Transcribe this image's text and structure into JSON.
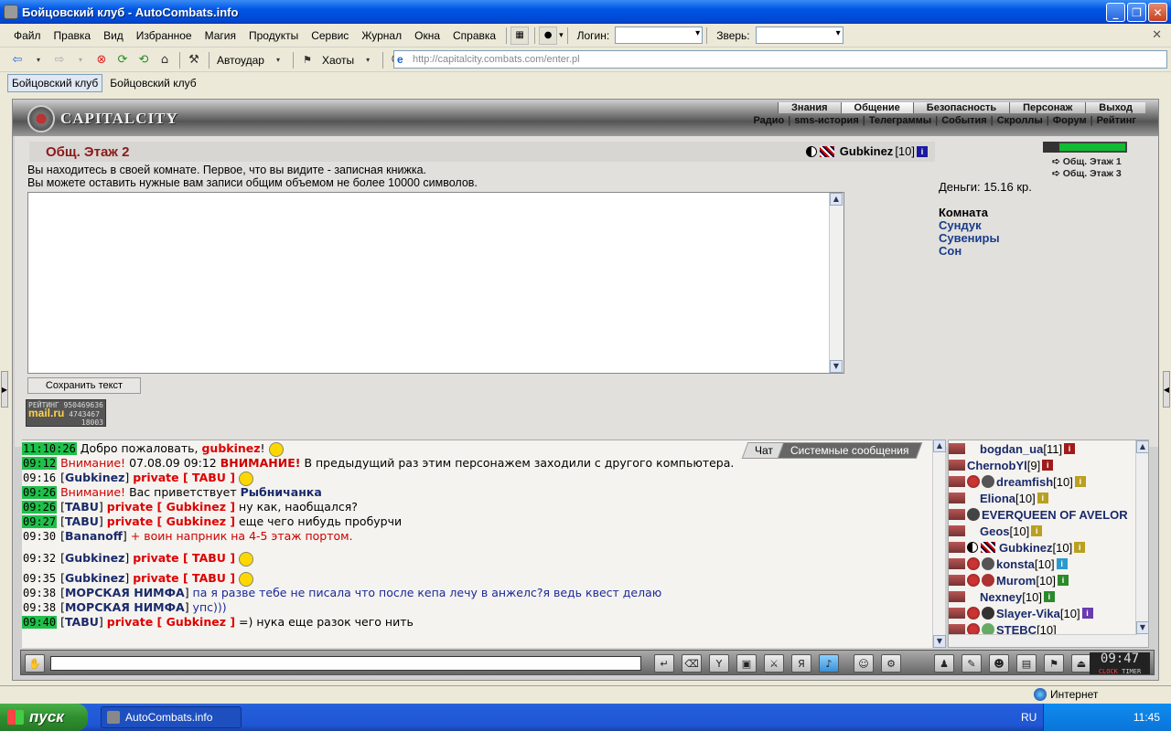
{
  "window": {
    "title": "Бойцовский клуб - AutoCombats.info"
  },
  "menu": {
    "items": [
      "Файл",
      "Правка",
      "Вид",
      "Избранное",
      "Магия",
      "Продукты",
      "Сервис",
      "Журнал",
      "Окна",
      "Справка"
    ],
    "login_label": "Логин:",
    "beast_label": "Зверь:"
  },
  "toolbar": {
    "autoudar": "Автоудар",
    "haoty": "Хаоты",
    "address": "http://capitalcity.combats.com/enter.pl"
  },
  "tabs": [
    "Бойцовский клуб",
    "Бойцовский клуб"
  ],
  "game": {
    "city_name": "CAPITALCITY",
    "nav_top": [
      "Знания",
      "Общение",
      "Безопасность",
      "Персонаж",
      "Выход"
    ],
    "nav_bottom": [
      "Радио",
      "sms-история",
      "Телеграммы",
      "События",
      "Скроллы",
      "Форум",
      "Рейтинг"
    ]
  },
  "room": {
    "title": "Общ. Этаж 2",
    "player_nick": "Gubkinez",
    "player_level": "[10]",
    "desc_line1": "Вы находитесь в своей комнате. Первое, что вы видите - записная книжка.",
    "desc_line2": "Вы можете оставить нужные вам записи общим объемом не более 10000 символов.",
    "save_button": "Сохранить текст",
    "counter_line1": "РЕЙТИНГ 950469636",
    "counter_brand": "mail.ru",
    "counter_line2": "4743467",
    "counter_line3": "18003"
  },
  "right": {
    "floor1": "Общ. Этаж 1",
    "floor3": "Общ. Этаж 3",
    "money": "Деньги: 15.16 кр.",
    "room_label": "Комната",
    "rooms": [
      "Сундук",
      "Сувениры",
      "Сон"
    ]
  },
  "chat": {
    "tab_chat": "Чат",
    "tab_system": "Системные сообщения",
    "lines": [
      {
        "time": "11:10:26",
        "hl": true,
        "pre": "",
        "nick": "",
        "text": "Добро пожаловать, ",
        "tail": "gubkinez",
        "end": "!"
      },
      {
        "time": "09:12",
        "hl": true,
        "warn": "Внимание!",
        "date": "07.08.09 09:12",
        "caps": "ВНИМАНИЕ!",
        "text": "В предыдущий раз этим персонажем заходили с другого компьютера."
      },
      {
        "time": "09:16",
        "hl": false,
        "nick": "Gubkinez",
        "priv": "private [ TABU ]"
      },
      {
        "time": "09:26",
        "hl": true,
        "warn": "Внимание!",
        "text": "Вас приветствует",
        "tail": "Рыбничанка"
      },
      {
        "time": "09:26",
        "hl": true,
        "nick": "TABU",
        "priv": "private [ Gubkinez ]",
        "text": "ну как, наобщался?"
      },
      {
        "time": "09:27",
        "hl": true,
        "nick": "TABU",
        "priv": "private [ Gubkinez ]",
        "text": "еще чего нибудь пробурчи"
      },
      {
        "time": "09:30",
        "hl": false,
        "nick": "Bananoff",
        "text": "+ воин напрник на 4-5 этаж портом."
      },
      {
        "time": "09:32",
        "hl": false,
        "nick": "Gubkinez",
        "priv": "private [ TABU ]"
      },
      {
        "time": "09:35",
        "hl": false,
        "nick": "Gubkinez",
        "priv": "private [ TABU ]"
      },
      {
        "time": "09:38",
        "hl": false,
        "nick": "МОРСКАЯ НИМФА",
        "text": "па я разве тебе не писала что после кепа лечу в анжелс?я ведь квест делаю"
      },
      {
        "time": "09:38",
        "hl": false,
        "nick": "МОРСКАЯ НИМФА",
        "text": "упс)))"
      },
      {
        "time": "09:40",
        "hl": true,
        "nick": "TABU",
        "priv": "private [ Gubkinez ]",
        "text": "=) нука еще разок чего нить"
      }
    ]
  },
  "online": [
    {
      "name": "bogdan_ua",
      "level": "[11]"
    },
    {
      "name": "ChernobYl",
      "level": "[9]"
    },
    {
      "name": "dreamfish",
      "level": "[10]"
    },
    {
      "name": "Eliona",
      "level": "[10]"
    },
    {
      "name": "EVERQUEEN OF AVELOR",
      "level": ""
    },
    {
      "name": "Geos",
      "level": "[10]"
    },
    {
      "name": "Gubkinez",
      "level": "[10]"
    },
    {
      "name": "konsta",
      "level": "[10]"
    },
    {
      "name": "Murom",
      "level": "[10]"
    },
    {
      "name": "Nexney",
      "level": "[10]"
    },
    {
      "name": "Slayer-Vika",
      "level": "[10]"
    },
    {
      "name": "STEBC",
      "level": "[10]"
    }
  ],
  "clock": {
    "time": "09:47",
    "sec": "47",
    "label1": "CLOCK",
    "label2": "TIMER"
  },
  "status": {
    "zone": "Интернет"
  },
  "taskbar": {
    "start": "пуск",
    "task": "AutoCombats.info",
    "lang": "RU",
    "time": "11:45"
  }
}
